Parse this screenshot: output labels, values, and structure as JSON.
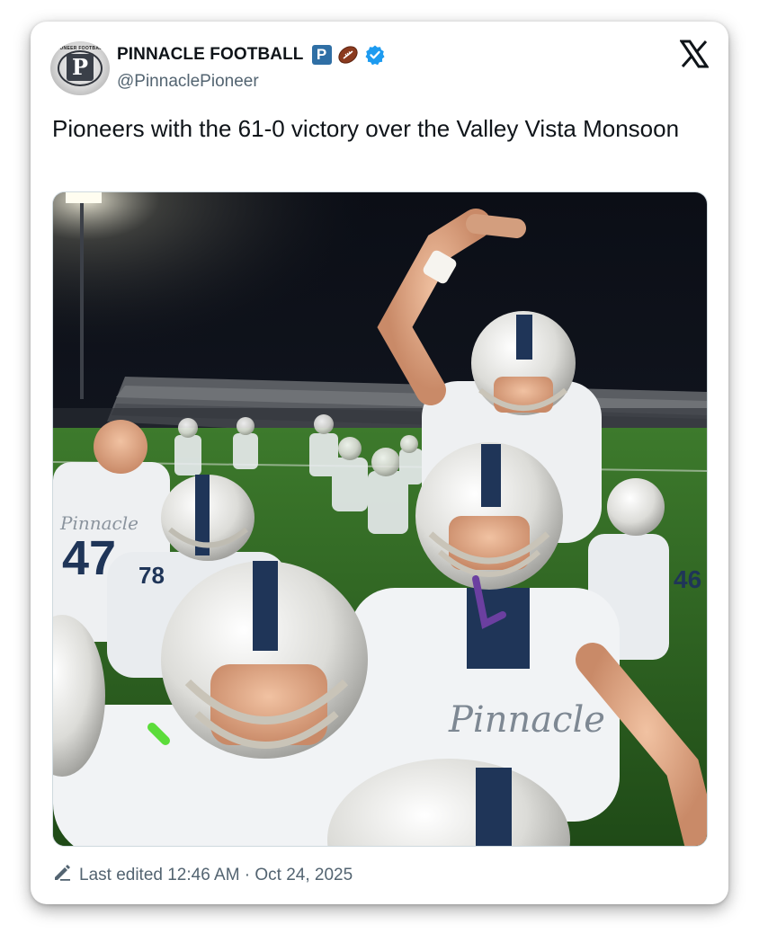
{
  "account": {
    "display_name": "PINNACLE FOOTBALL",
    "badge_letter": "P",
    "handle": "@PinnaclePioneer",
    "avatar_text": "PIONEER FOOTBALL",
    "avatar_letter": "P"
  },
  "tweet": {
    "text": "Pioneers with the 61-0 victory over the Valley Vista Monsoon",
    "image_alt": "Photo of Pinnacle football players in white helmets and jerseys celebrating on the field at night"
  },
  "footer": {
    "edited_text": "Last edited 12:46 AM · Oct 24, 2025"
  },
  "photo_text": {
    "jersey_1": "47",
    "jersey_2": "78",
    "jersey_3": "Pinnacle",
    "jersey_4": "Pinnacle",
    "jersey_5": "46"
  },
  "icons": {
    "x_logo": "x-logo-icon",
    "verified": "verified-badge-icon",
    "football": "football-emoji-icon",
    "edit": "pencil-edit-icon"
  },
  "colors": {
    "verified_blue": "#1d9bf0",
    "badge_blue": "#2f6fa5",
    "text_primary": "#0f1419",
    "text_secondary": "#536471",
    "helmet_stripe_navy": "#1f3558"
  }
}
